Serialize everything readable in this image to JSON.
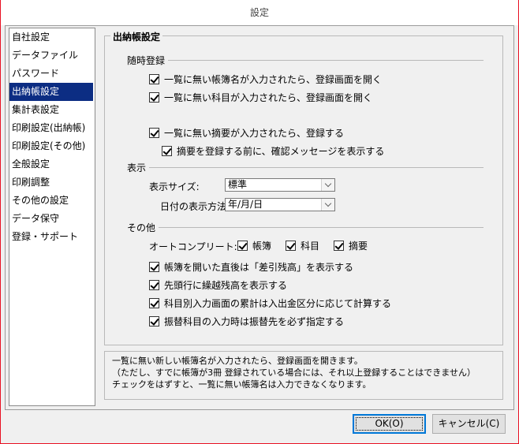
{
  "window": {
    "title": "設定"
  },
  "sidebar": {
    "items": [
      {
        "label": "自社設定"
      },
      {
        "label": "データファイル"
      },
      {
        "label": "パスワード"
      },
      {
        "label": "出納帳設定",
        "selected": true
      },
      {
        "label": "集計表設定"
      },
      {
        "label": "印刷設定(出納帳)"
      },
      {
        "label": "印刷設定(その他)"
      },
      {
        "label": "全般設定"
      },
      {
        "label": "印刷調整"
      },
      {
        "label": "その他の設定"
      },
      {
        "label": "データ保守"
      },
      {
        "label": "登録・サポート"
      }
    ]
  },
  "group": {
    "title": "出納帳設定",
    "sections": {
      "instant_register": {
        "label": "随時登録",
        "checks": [
          {
            "label": "一覧に無い帳簿名が入力されたら、登録画面を開く",
            "checked": true
          },
          {
            "label": "一覧に無い科目が入力されたら、登録画面を開く",
            "checked": true
          },
          {
            "label": "一覧に無い摘要が入力されたら、登録する",
            "checked": true
          },
          {
            "label": "摘要を登録する前に、確認メッセージを表示する",
            "checked": true
          }
        ]
      },
      "display": {
        "label": "表示",
        "size_label": "表示サイズ:",
        "size_value": "標準",
        "date_label": "日付の表示方法:",
        "date_value": "年/月/日"
      },
      "other": {
        "label": "その他",
        "autocomplete_label": "オートコンプリート:",
        "autocomplete": [
          {
            "label": "帳簿",
            "checked": true
          },
          {
            "label": "科目",
            "checked": true
          },
          {
            "label": "摘要",
            "checked": true
          }
        ],
        "checks": [
          {
            "label": "帳簿を開いた直後は「差引残高」を表示する",
            "checked": true
          },
          {
            "label": "先頭行に繰越残高を表示する",
            "checked": true
          },
          {
            "label": "科目別入力画面の累計は入出金区分に応じて計算する",
            "checked": true
          },
          {
            "label": "振替科目の入力時は振替先を必ず指定する",
            "checked": true
          }
        ]
      }
    }
  },
  "description": {
    "line1": "一覧に無い新しい帳簿名が入力されたら、登録画面を開きます。",
    "line2": "（ただし、すでに帳簿が3冊 登録されている場合には、それ以上登録することはできません）",
    "line3": "チェックをはずすと、一覧に無い帳簿名は入力できなくなります。"
  },
  "buttons": {
    "ok": "OK(O)",
    "cancel": "キャンセル(C)"
  }
}
